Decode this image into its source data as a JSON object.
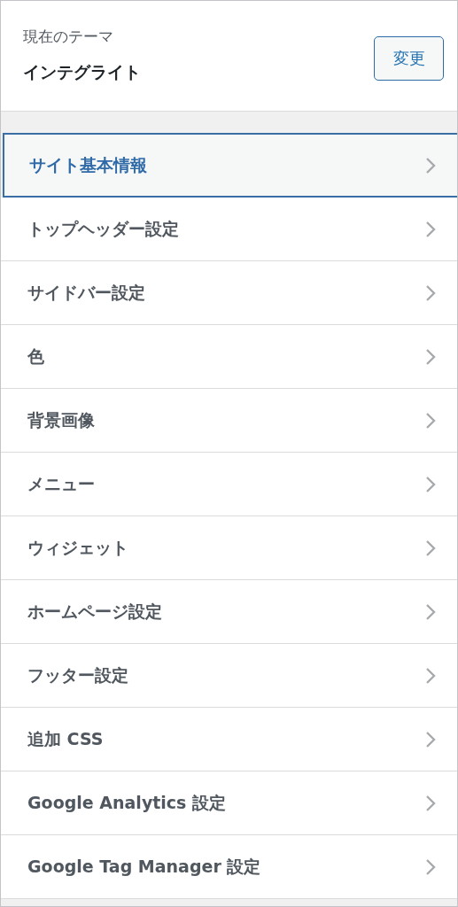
{
  "current_theme": {
    "label": "現在のテーマ",
    "name": "インテグライト",
    "change_button": "変更"
  },
  "sections": [
    {
      "label": "サイト基本情報",
      "selected": true
    },
    {
      "label": "トップヘッダー設定",
      "selected": false
    },
    {
      "label": "サイドバー設定",
      "selected": false
    },
    {
      "label": "色",
      "selected": false
    },
    {
      "label": "背景画像",
      "selected": false
    },
    {
      "label": "メニュー",
      "selected": false
    },
    {
      "label": "ウィジェット",
      "selected": false
    },
    {
      "label": "ホームページ設定",
      "selected": false
    },
    {
      "label": "フッター設定",
      "selected": false
    },
    {
      "label": "追加 CSS",
      "selected": false
    },
    {
      "label": "Google Analytics 設定",
      "selected": false
    },
    {
      "label": "Google Tag Manager 設定",
      "selected": false
    }
  ]
}
